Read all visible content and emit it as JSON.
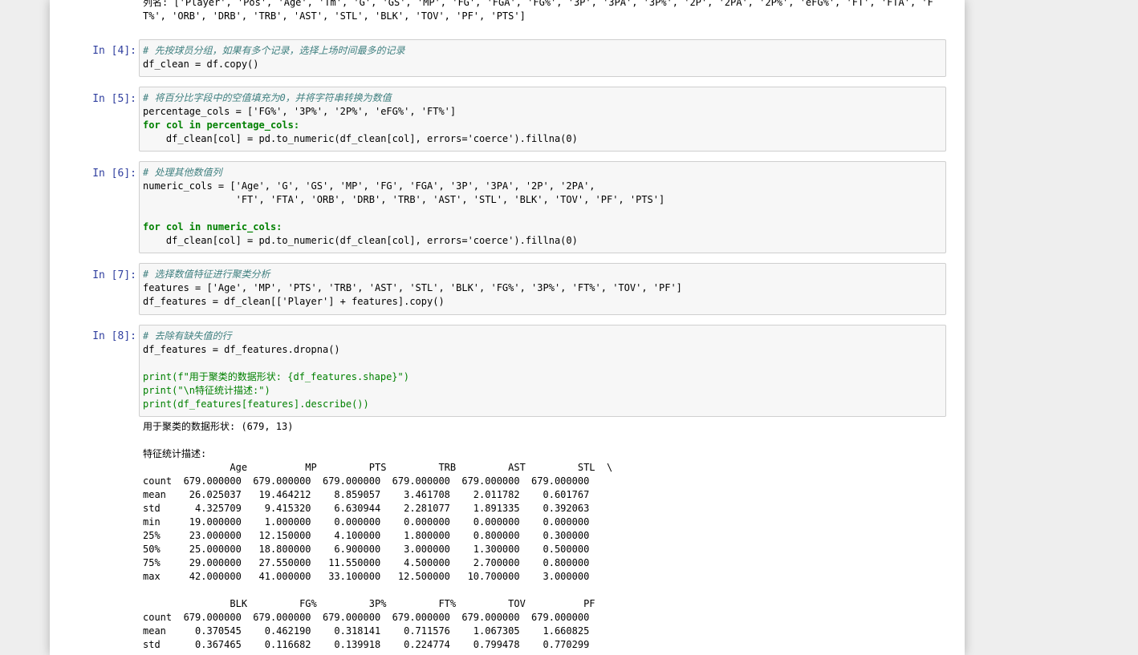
{
  "top_output": {
    "line1": "列名: ['Player', 'Pos', 'Age', 'Tm', 'G', 'GS', 'MP', 'FG', 'FGA', 'FG%', '3P', '3PA', '3P%', '2P', '2PA', '2P%', 'eFG%', 'FT', 'FTA', 'F",
    "line2": "T%', 'ORB', 'DRB', 'TRB', 'AST', 'STL', 'BLK', 'TOV', 'PF', 'PTS']"
  },
  "cells": [
    {
      "prompt": "In [4]:",
      "comment": "# 先按球员分组，如果有多个记录，选择上场时间最多的记录",
      "code_line": "df_clean = df.copy()"
    },
    {
      "prompt": "In [5]:",
      "comment": "# 将百分比字段中的空值填充为0，并将字符串转换为数值",
      "percentage_line": "percentage_cols = ['FG%', '3P%', '2P%', 'eFG%', 'FT%']",
      "for_line": "for col in percentage_cols:",
      "body_line": "    df_clean[col] = pd.to_numeric(df_clean[col], errors='coerce').fillna(0)"
    },
    {
      "prompt": "In [6]:",
      "comment": "# 处理其他数值列",
      "numeric_line1": "numeric_cols = ['Age', 'G', 'GS', 'MP', 'FG', 'FGA', '3P', '3PA', '2P', '2PA',",
      "numeric_line2": "                'FT', 'FTA', 'ORB', 'DRB', 'TRB', 'AST', 'STL', 'BLK', 'TOV', 'PF', 'PTS']",
      "for_line": "for col in numeric_cols:",
      "body_line": "    df_clean[col] = pd.to_numeric(df_clean[col], errors='coerce').fillna(0)"
    },
    {
      "prompt": "In [7]:",
      "comment": "# 选择数值特征进行聚类分析",
      "features_line": "features = ['Age', 'MP', 'PTS', 'TRB', 'AST', 'STL', 'BLK', 'FG%', '3P%', 'FT%', 'TOV', 'PF']",
      "df_features_line": "df_features = df_clean[['Player'] + features].copy()"
    },
    {
      "prompt": "In [8]:",
      "comment": "# 去除有缺失值的行",
      "dropna_line": "df_features = df_features.dropna()",
      "print1": "print(f\"用于聚类的数据形状: {df_features.shape}\")",
      "print2": "print(\"\\n特征统计描述:\")",
      "print3": "print(df_features[features].describe())"
    }
  ],
  "output": {
    "shape_line": "用于聚类的数据形状: (679, 13)",
    "desc_title": "特征统计描述:",
    "table1": {
      "header": "               Age          MP         PTS         TRB         AST         STL  \\",
      "rows": [
        "count  679.000000  679.000000  679.000000  679.000000  679.000000  679.000000",
        "mean    26.025037   19.464212    8.859057    3.461708    2.011782    0.601767",
        "std      4.325709    9.415320    6.630944    2.281077    1.891335    0.392063",
        "min     19.000000    1.000000    0.000000    0.000000    0.000000    0.000000",
        "25%     23.000000   12.150000    4.100000    1.800000    0.800000    0.300000",
        "50%     25.000000   18.800000    6.900000    3.000000    1.300000    0.500000",
        "75%     29.000000   27.550000   11.550000    4.500000    2.700000    0.800000",
        "max     42.000000   41.000000   33.100000   12.500000   10.700000    3.000000"
      ]
    },
    "table2": {
      "header": "               BLK         FG%         3P%         FT%         TOV          PF",
      "rows": [
        "count  679.000000  679.000000  679.000000  679.000000  679.000000  679.000000",
        "mean     0.370545    0.462190    0.318141    0.711576    1.067305    1.660825",
        "std      0.367465    0.116682    0.139918    0.224774    0.799478    0.770299"
      ]
    }
  }
}
